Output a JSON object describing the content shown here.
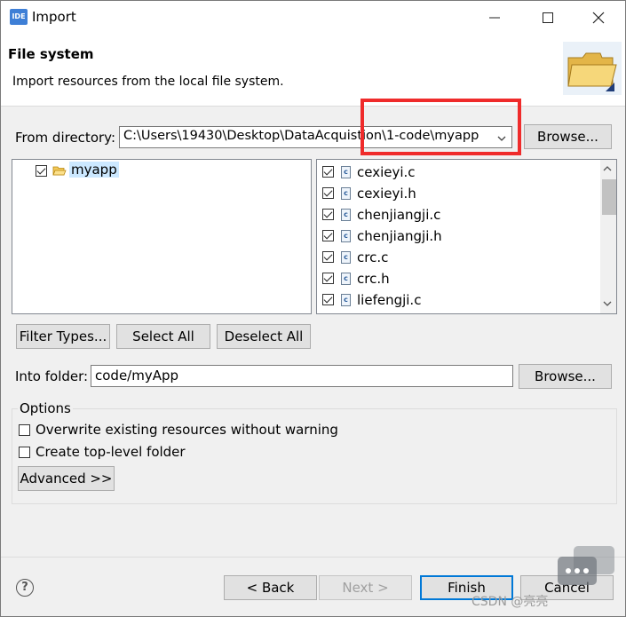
{
  "window": {
    "icon_text": "IDE",
    "title": "Import"
  },
  "header": {
    "title": "File system",
    "description": "Import resources from the local file system."
  },
  "from_directory": {
    "label": "From directory:",
    "value": "C:\\Users\\19430\\Desktop\\DataAcquistion\\1-code\\myapp",
    "browse_label": "Browse..."
  },
  "tree": {
    "items": [
      {
        "label": "myapp",
        "checked": true
      }
    ]
  },
  "files": [
    {
      "name": "cexieyi.c",
      "checked": true
    },
    {
      "name": "cexieyi.h",
      "checked": true
    },
    {
      "name": "chenjiangji.c",
      "checked": true
    },
    {
      "name": "chenjiangji.h",
      "checked": true
    },
    {
      "name": "crc.c",
      "checked": true
    },
    {
      "name": "crc.h",
      "checked": true
    },
    {
      "name": "liefengji.c",
      "checked": true
    }
  ],
  "selection_buttons": {
    "filter_types": "Filter Types...",
    "select_all": "Select All",
    "deselect_all": "Deselect All"
  },
  "into_folder": {
    "label": "Into folder:",
    "value": "code/myApp",
    "browse_label": "Browse..."
  },
  "options": {
    "title": "Options",
    "overwrite": {
      "label": "Overwrite existing resources without warning",
      "checked": false
    },
    "create_top_level": {
      "label": "Create top-level folder",
      "checked": false
    },
    "advanced_label": "Advanced >>"
  },
  "footer": {
    "back_label": "< Back",
    "next_label": "Next >",
    "finish_label": "Finish",
    "cancel_label": "Cancel"
  },
  "watermark": "CSDN @亮亮",
  "colors": {
    "highlight_border": "#ef2b2b",
    "accent": "#0078d7"
  }
}
